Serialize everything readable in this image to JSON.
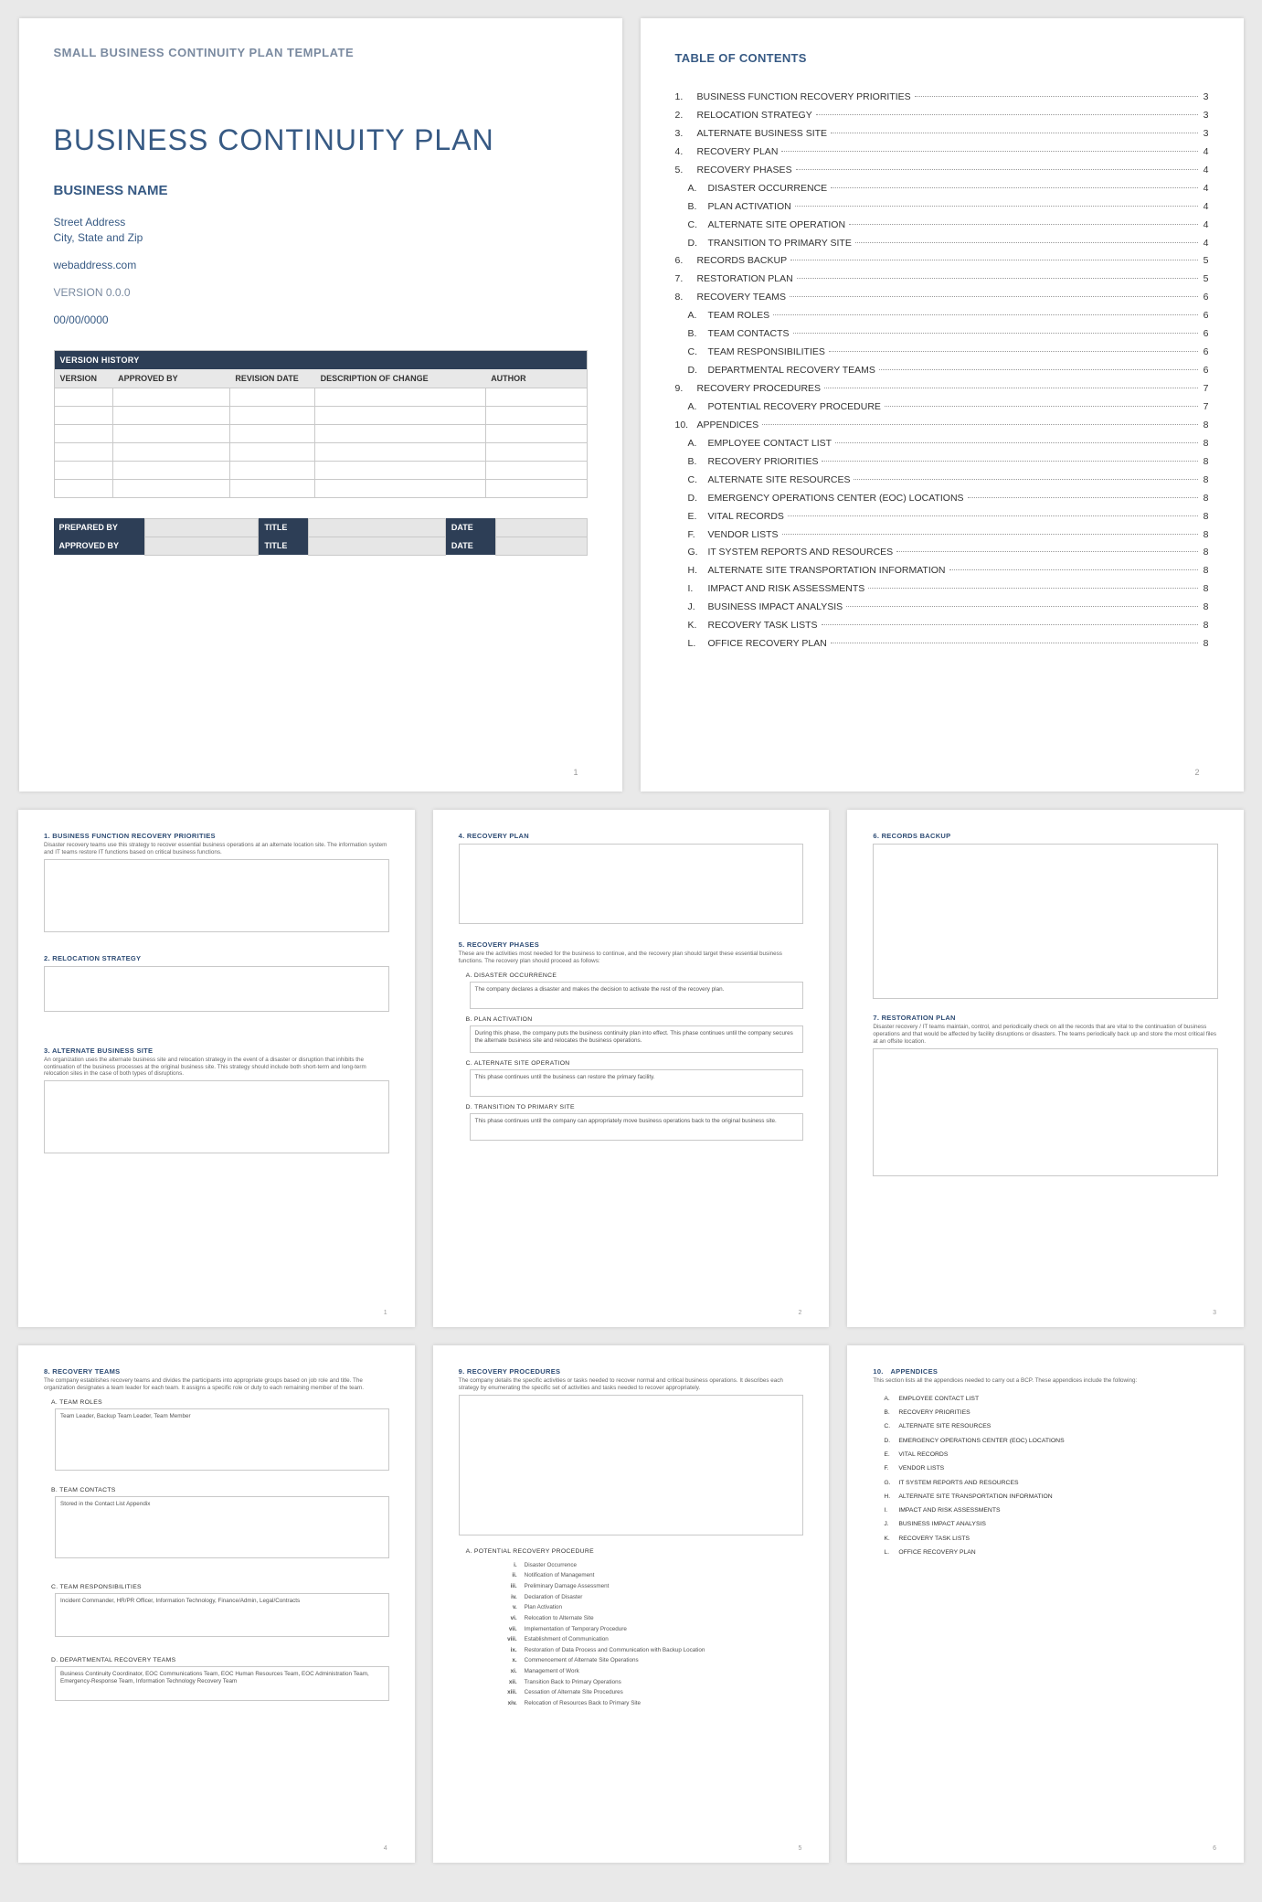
{
  "page1": {
    "template_head": "SMALL BUSINESS CONTINUITY PLAN TEMPLATE",
    "title": "BUSINESS CONTINUITY PLAN",
    "business_name": "BUSINESS NAME",
    "addr_line1": "Street Address",
    "addr_line2": "City, State and Zip",
    "web": "webaddress.com",
    "version": "VERSION 0.0.0",
    "date": "00/00/0000",
    "vh_title": "VERSION HISTORY",
    "vh_cols": [
      "VERSION",
      "APPROVED BY",
      "REVISION DATE",
      "DESCRIPTION OF CHANGE",
      "AUTHOR"
    ],
    "sign": {
      "prepared": "PREPARED BY",
      "approved": "APPROVED BY",
      "title": "TITLE",
      "date": "DATE"
    },
    "pnum": "1"
  },
  "toc": {
    "heading": "TABLE OF CONTENTS",
    "pnum": "2",
    "items": [
      {
        "n": "1.",
        "t": "BUSINESS FUNCTION RECOVERY PRIORITIES",
        "p": "3"
      },
      {
        "n": "2.",
        "t": "RELOCATION STRATEGY",
        "p": "3"
      },
      {
        "n": "3.",
        "t": "ALTERNATE BUSINESS SITE",
        "p": "3"
      },
      {
        "n": "4.",
        "t": "RECOVERY PLAN",
        "p": "4"
      },
      {
        "n": "5.",
        "t": "RECOVERY PHASES",
        "p": "4"
      },
      {
        "n": "A.",
        "t": "DISASTER OCCURRENCE",
        "p": "4",
        "sub": true
      },
      {
        "n": "B.",
        "t": "PLAN ACTIVATION",
        "p": "4",
        "sub": true
      },
      {
        "n": "C.",
        "t": "ALTERNATE SITE OPERATION",
        "p": "4",
        "sub": true
      },
      {
        "n": "D.",
        "t": "TRANSITION TO PRIMARY SITE",
        "p": "4",
        "sub": true
      },
      {
        "n": "6.",
        "t": "RECORDS BACKUP",
        "p": "5"
      },
      {
        "n": "7.",
        "t": "RESTORATION PLAN",
        "p": "5"
      },
      {
        "n": "8.",
        "t": "RECOVERY TEAMS",
        "p": "6"
      },
      {
        "n": "A.",
        "t": "TEAM ROLES",
        "p": "6",
        "sub": true
      },
      {
        "n": "B.",
        "t": "TEAM CONTACTS",
        "p": "6",
        "sub": true
      },
      {
        "n": "C.",
        "t": "TEAM RESPONSIBILITIES",
        "p": "6",
        "sub": true
      },
      {
        "n": "D.",
        "t": "DEPARTMENTAL RECOVERY TEAMS",
        "p": "6",
        "sub": true
      },
      {
        "n": "9.",
        "t": "RECOVERY PROCEDURES",
        "p": "7"
      },
      {
        "n": "A.",
        "t": "POTENTIAL RECOVERY PROCEDURE",
        "p": "7",
        "sub": true
      },
      {
        "n": "10.",
        "t": "APPENDICES",
        "p": "8"
      },
      {
        "n": "A.",
        "t": "EMPLOYEE CONTACT LIST",
        "p": "8",
        "sub": true
      },
      {
        "n": "B.",
        "t": "RECOVERY PRIORITIES",
        "p": "8",
        "sub": true
      },
      {
        "n": "C.",
        "t": "ALTERNATE SITE RESOURCES",
        "p": "8",
        "sub": true
      },
      {
        "n": "D.",
        "t": "EMERGENCY OPERATIONS CENTER (EOC) LOCATIONS",
        "p": "8",
        "sub": true
      },
      {
        "n": "E.",
        "t": "VITAL RECORDS",
        "p": "8",
        "sub": true
      },
      {
        "n": "F.",
        "t": "VENDOR LISTS",
        "p": "8",
        "sub": true
      },
      {
        "n": "G.",
        "t": "IT SYSTEM REPORTS AND RESOURCES",
        "p": "8",
        "sub": true
      },
      {
        "n": "H.",
        "t": "ALTERNATE SITE TRANSPORTATION INFORMATION",
        "p": "8",
        "sub": true
      },
      {
        "n": "I.",
        "t": "IMPACT AND RISK ASSESSMENTS",
        "p": "8",
        "sub": true
      },
      {
        "n": "J.",
        "t": "BUSINESS IMPACT ANALYSIS",
        "p": "8",
        "sub": true
      },
      {
        "n": "K.",
        "t": "RECOVERY TASK LISTS",
        "p": "8",
        "sub": true
      },
      {
        "n": "L.",
        "t": "OFFICE RECOVERY PLAN",
        "p": "8",
        "sub": true
      }
    ]
  },
  "p3": {
    "pnum": "1",
    "s1_title": "1. BUSINESS FUNCTION RECOVERY PRIORITIES",
    "s1_desc": "Disaster recovery teams use this strategy to recover essential business operations at an alternate location site. The information system and IT teams restore IT functions based on critical business functions.",
    "s2_title": "2. RELOCATION STRATEGY",
    "s3_title": "3. ALTERNATE BUSINESS SITE",
    "s3_desc": "An organization uses the alternate business site and relocation strategy in the event of a disaster or disruption that inhibits the continuation of the business processes at the original business site. This strategy should include both short-term and long-term relocation sites in the case of both types of disruptions."
  },
  "p4": {
    "pnum": "2",
    "s4_title": "4. RECOVERY PLAN",
    "s5_title": "5. RECOVERY PHASES",
    "s5_desc": "These are the activities most needed for the business to continue, and the recovery plan should target these essential business functions. The recovery plan should proceed as follows:",
    "a_title": "A. DISASTER OCCURRENCE",
    "a_text": "The company declares a disaster and makes the decision to activate the rest of the recovery plan.",
    "b_title": "B. PLAN ACTIVATION",
    "b_text": "During this phase, the company puts the business continuity plan into effect. This phase continues until the company secures the alternate business site and relocates the business operations.",
    "c_title": "C. ALTERNATE SITE OPERATION",
    "c_text": "This phase continues until the business can restore the primary facility.",
    "d_title": "D. TRANSITION TO PRIMARY SITE",
    "d_text": "This phase continues until the company can appropriately move business operations back to the original business site."
  },
  "p5": {
    "pnum": "3",
    "s6_title": "6. RECORDS BACKUP",
    "s7_title": "7. RESTORATION PLAN",
    "s7_desc": "Disaster recovery / IT teams maintain, control, and periodically check on all the records that are vital to the continuation of business operations and that would be affected by facility disruptions or disasters. The teams periodically back up and store the most critical files at an offsite location."
  },
  "p6": {
    "pnum": "4",
    "s8_title": "8. RECOVERY TEAMS",
    "s8_desc": "The company establishes recovery teams and divides the participants into appropriate groups based on job role and title. The organization designates a team leader for each team. It assigns a specific role or duty to each remaining member of the team.",
    "a_title": "A. TEAM ROLES",
    "a_text": "Team Leader, Backup Team Leader, Team Member",
    "b_title": "B. TEAM CONTACTS",
    "b_text": "Stored in the Contact List Appendix",
    "c_title": "C. TEAM RESPONSIBILITIES",
    "c_text": "Incident Commander, HR/PR Officer, Information Technology, Finance/Admin, Legal/Contracts",
    "d_title": "D. DEPARTMENTAL RECOVERY TEAMS",
    "d_text": "Business Continuity Coordinator, EOC Communications Team, EOC Human Resources Team, EOC Administration Team, Emergency-Response Team, Information Technology Recovery Team"
  },
  "p7": {
    "pnum": "5",
    "s9_title": "9. RECOVERY PROCEDURES",
    "s9_desc": "The company details the specific activities or tasks needed to recover normal and critical business operations. It describes each strategy by enumerating the specific set of activities and tasks needed to recover appropriately.",
    "a_title": "A. POTENTIAL RECOVERY PROCEDURE",
    "steps": [
      {
        "r": "i.",
        "t": "Disaster Occurrence"
      },
      {
        "r": "ii.",
        "t": "Notification of Management"
      },
      {
        "r": "iii.",
        "t": "Preliminary Damage Assessment"
      },
      {
        "r": "iv.",
        "t": "Declaration of Disaster"
      },
      {
        "r": "v.",
        "t": "Plan Activation"
      },
      {
        "r": "vi.",
        "t": "Relocation to Alternate Site"
      },
      {
        "r": "vii.",
        "t": "Implementation of Temporary Procedure"
      },
      {
        "r": "viii.",
        "t": "Establishment of Communication"
      },
      {
        "r": "ix.",
        "t": "Restoration of Data Process and Communication with Backup Location"
      },
      {
        "r": "x.",
        "t": "Commencement of Alternate Site Operations"
      },
      {
        "r": "xi.",
        "t": "Management of Work"
      },
      {
        "r": "xii.",
        "t": "Transition Back to Primary Operations"
      },
      {
        "r": "xiii.",
        "t": "Cessation of Alternate Site Procedures"
      },
      {
        "r": "xiv.",
        "t": "Relocation of Resources Back to Primary Site"
      }
    ]
  },
  "p8": {
    "pnum": "6",
    "s10_title": "10. APPENDICES",
    "desc": "This section lists all the appendices needed to carry out a BCP. These appendices include the following:",
    "items": [
      {
        "l": "A.",
        "t": "EMPLOYEE CONTACT LIST"
      },
      {
        "l": "B.",
        "t": "RECOVERY PRIORITIES"
      },
      {
        "l": "C.",
        "t": "ALTERNATE SITE RESOURCES"
      },
      {
        "l": "D.",
        "t": "EMERGENCY OPERATIONS CENTER (EOC) LOCATIONS"
      },
      {
        "l": "E.",
        "t": "VITAL RECORDS"
      },
      {
        "l": "F.",
        "t": "VENDOR LISTS"
      },
      {
        "l": "G.",
        "t": "IT SYSTEM REPORTS AND RESOURCES"
      },
      {
        "l": "H.",
        "t": "ALTERNATE SITE TRANSPORTATION INFORMATION"
      },
      {
        "l": "I.",
        "t": "IMPACT AND RISK ASSESSMENTS"
      },
      {
        "l": "J.",
        "t": "BUSINESS IMPACT ANALYSIS"
      },
      {
        "l": "K.",
        "t": "RECOVERY TASK LISTS"
      },
      {
        "l": "L.",
        "t": "OFFICE RECOVERY PLAN"
      }
    ]
  }
}
